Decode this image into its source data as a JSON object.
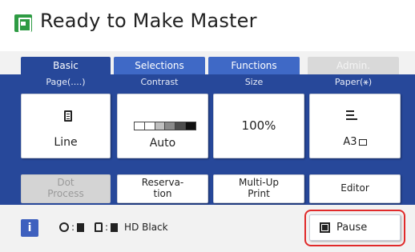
{
  "header": {
    "title": "Ready to Make Master",
    "icon": "master-icon",
    "icon_color": "#2e9b43"
  },
  "tabs": [
    {
      "label": "Basic",
      "active": true
    },
    {
      "label": "Selections"
    },
    {
      "label": "Functions"
    },
    {
      "label": "Admin.",
      "disabled": true
    }
  ],
  "settings": {
    "page": {
      "label": "Page(....)",
      "value": "Line",
      "icon": "document-icon"
    },
    "contrast": {
      "label": "Contrast",
      "value": "Auto"
    },
    "size": {
      "label": "Size",
      "value": "100%"
    },
    "paper": {
      "label": "Paper(⚹)",
      "value": "A3",
      "icon": "paper-stack-icon"
    }
  },
  "functions": {
    "dot_process": "Dot\nProcess",
    "reservation": "Reserva-\ntion",
    "multi_up": "Multi-Up\nPrint",
    "editor": "Editor"
  },
  "status": {
    "drum_icon": "drum-icon",
    "ink_icon": "ink-icon",
    "ink": "HD Black"
  },
  "pause": {
    "label": "Pause"
  },
  "colors": {
    "accent": "#27489a",
    "tab_inactive": "#3f69c6",
    "highlight": "#e02a2a"
  }
}
